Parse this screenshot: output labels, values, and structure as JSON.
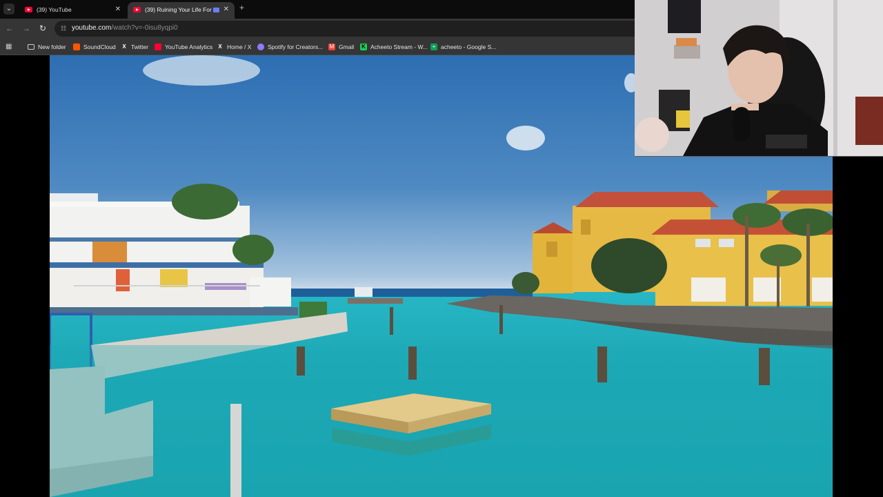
{
  "browser": {
    "tabs": [
      {
        "title": "(39) YouTube",
        "active": false
      },
      {
        "title": "(39) Ruining Your Life For T",
        "active": true
      }
    ],
    "tab_list_icon": "chevron-down-icon",
    "new_tab_icon": "plus-icon",
    "url": {
      "host": "youtube.com",
      "path": "/watch?v=-0isu8yqpi0"
    },
    "bookmarks": [
      {
        "label": "New folder",
        "icon": "folder-icon"
      },
      {
        "label": "SoundCloud",
        "icon": "soundcloud-icon"
      },
      {
        "label": "Twitter",
        "icon": "x-icon"
      },
      {
        "label": "YouTube Analytics",
        "icon": "youtube-icon"
      },
      {
        "label": "Home / X",
        "icon": "x-icon"
      },
      {
        "label": "Spotify for Creators...",
        "icon": "spotify-for-creators-icon"
      },
      {
        "label": "Gmail",
        "icon": "gmail-icon"
      },
      {
        "label": "Acheeto Stream - W...",
        "icon": "kick-icon"
      },
      {
        "label": "acheeto - Google S...",
        "icon": "google-sheets-icon"
      }
    ]
  },
  "video": {
    "description": "Tropical harbor: white building with balconies on the left, yellow buildings with red-tile roofs and palm trees on the right, turquoise water with a floating wooden platform and mooring posts"
  },
  "webcam": {
    "description": "Streamer overlay: person with headphones and a black t-shirt speaking into a microphone"
  },
  "colors": {
    "tabbar_bg": "#0c0c0c",
    "toolbar_bg": "#353535",
    "omnibox_bg": "#1f1f1f",
    "youtube_red": "#ff0033"
  }
}
